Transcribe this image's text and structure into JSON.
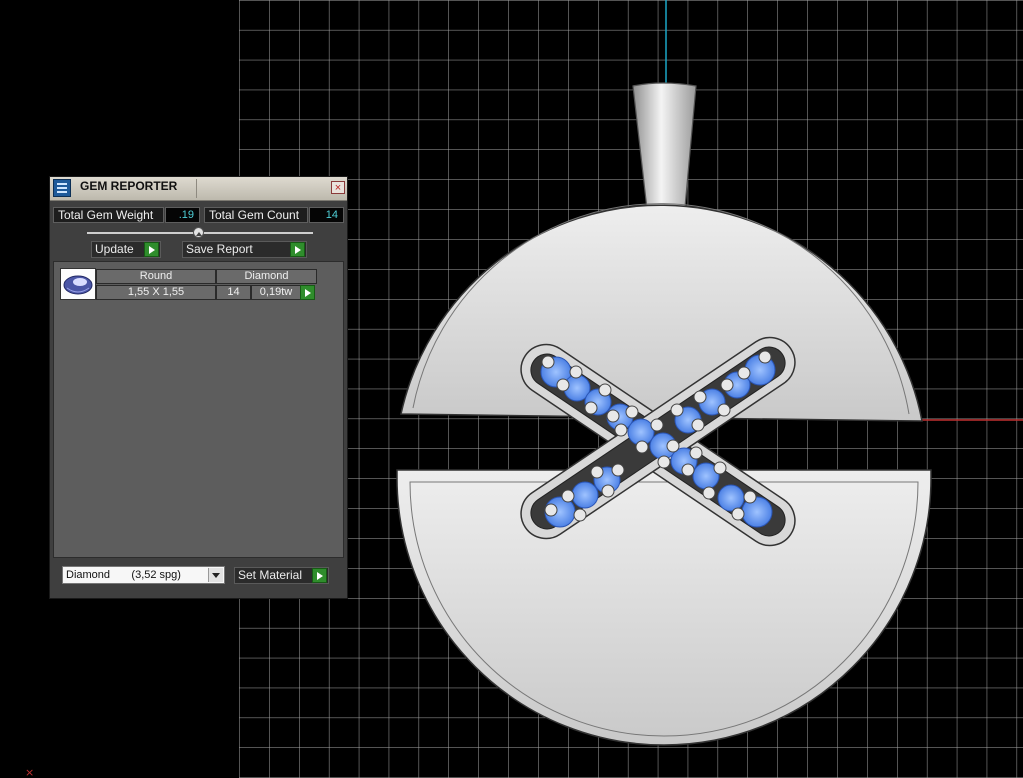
{
  "window": {
    "title": "GEM REPORTER",
    "close_icon": "×"
  },
  "stats": {
    "total_weight_label": "Total Gem Weight",
    "total_weight_value": ".19",
    "total_count_label": "Total Gem Count",
    "total_count_value": "14"
  },
  "actions": {
    "update_label": "Update",
    "save_report_label": "Save Report"
  },
  "gem_table": {
    "headers": {
      "shape": "Round",
      "material": "Diamond"
    },
    "rows": [
      {
        "thumbnail_icon": "gem-thumbnail-icon",
        "size": "1,55 X 1,55",
        "count": "14",
        "weight": "0,19tw"
      }
    ]
  },
  "material": {
    "selected": "Diamond       (3,52 spg)",
    "set_label": "Set Material"
  },
  "colors": {
    "panel_bg": "#3f3f3f",
    "value_text": "#4fd0d8",
    "go_button": "#2f8d2c",
    "gem_blue": "#4f86e8",
    "metal": "#cfcfcf"
  }
}
